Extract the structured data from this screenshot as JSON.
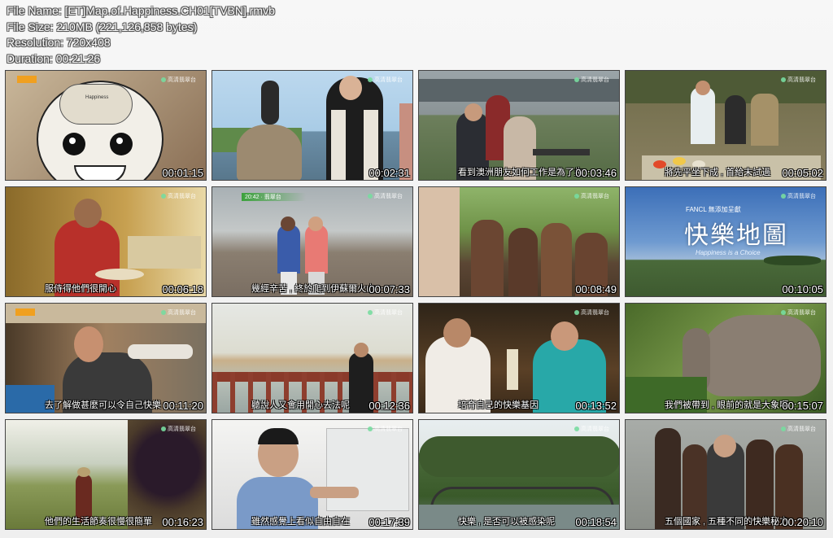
{
  "file_info": {
    "name": "File Name: [ET]Map.of.Happiness.CH01[TVBN].rmvb",
    "size": "File Size: 210MB (221,126,858 bytes)",
    "resolution": "Resolution: 720x408",
    "duration": "Duration: 00:21:26"
  },
  "channel_logo": "高清翡翠台",
  "thumbnails": [
    {
      "time": "00:01:15",
      "subtitle": "",
      "scene": "cartoon-head"
    },
    {
      "time": "00:02:31",
      "subtitle": "",
      "scene": "mermaid-statue"
    },
    {
      "time": "00:03:46",
      "subtitle": "看到澳洲朋友如何工作是為了生",
      "scene": "park-bench"
    },
    {
      "time": "00:05:02",
      "subtitle": "將先平坐下成 , 首給末試過",
      "scene": "outdoor-cooking"
    },
    {
      "time": "00:06:18",
      "subtitle": "服侍得他們很開心",
      "scene": "kitchen-woman"
    },
    {
      "time": "00:07:33",
      "subtitle": "幾經辛苦 , 終於爬到伊蘇爾火山",
      "scene": "volcano-walk"
    },
    {
      "time": "00:08:49",
      "subtitle": "",
      "scene": "tribe-crowd"
    },
    {
      "time": "00:10:05",
      "subtitle": "",
      "scene": "title-card"
    },
    {
      "time": "00:11:20",
      "subtitle": "去了解做甚麼可以令自己快樂",
      "scene": "market-eating"
    },
    {
      "time": "00:12:36",
      "subtitle": "聽說人又會用開心去法呢",
      "scene": "lake-bridge"
    },
    {
      "time": "00:13:52",
      "subtitle": "培育自己的快樂基因",
      "scene": "craft-talk"
    },
    {
      "time": "00:15:07",
      "subtitle": "我們被帶到 , 眼前的就是大象啊",
      "scene": "elephant"
    },
    {
      "time": "00:16:23",
      "subtitle": "他們的生活節奏很慢很簡單",
      "scene": "vineyard"
    },
    {
      "time": "00:17:39",
      "subtitle": "雖然感覺上看似自由自在",
      "scene": "office-host"
    },
    {
      "time": "00:18:54",
      "subtitle": "快樂 , 是否可以被感染呢",
      "scene": "park-bridge"
    },
    {
      "time": "00:20:10",
      "subtitle": "五個國家 , 五種不同的快樂秘方",
      "scene": "kids-group"
    }
  ],
  "title_card": {
    "sponsor": "FANCL 無添加呈獻",
    "title": "快樂地圖",
    "tagline": "Happiness is a Choice"
  },
  "bubble_label": "Happiness",
  "lower_third": "20:42 · 翡翠台"
}
